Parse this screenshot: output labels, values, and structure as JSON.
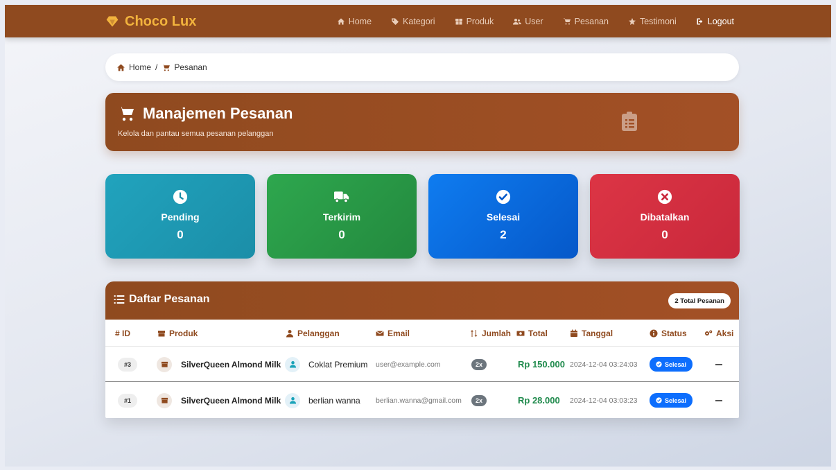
{
  "brand": {
    "name": "Choco Lux"
  },
  "nav": {
    "items": [
      {
        "label": "Home",
        "icon": "home-icon"
      },
      {
        "label": "Kategori",
        "icon": "tags-icon"
      },
      {
        "label": "Produk",
        "icon": "box-icon"
      },
      {
        "label": "User",
        "icon": "users-icon"
      },
      {
        "label": "Pesanan",
        "icon": "cart-icon"
      },
      {
        "label": "Testimoni",
        "icon": "star-icon"
      },
      {
        "label": "Logout",
        "icon": "logout-icon"
      }
    ]
  },
  "breadcrumb": {
    "home": "Home",
    "separator": "/",
    "current": "Pesanan"
  },
  "banner": {
    "title": "Manajemen Pesanan",
    "subtitle": "Kelola dan pantau semua pesanan pelanggan"
  },
  "stats": {
    "pending": {
      "label": "Pending",
      "value": "0"
    },
    "sent": {
      "label": "Terkirim",
      "value": "0"
    },
    "done": {
      "label": "Selesai",
      "value": "2"
    },
    "cancel": {
      "label": "Dibatalkan",
      "value": "0"
    }
  },
  "table": {
    "title": "Daftar Pesanan",
    "total_badge": "2 Total Pesanan",
    "columns": {
      "id": "# ID",
      "produk": "Produk",
      "pelanggan": "Pelanggan",
      "email": "Email",
      "jumlah": "Jumlah",
      "total": "Total",
      "tanggal": "Tanggal",
      "status": "Status",
      "aksi": "Aksi"
    },
    "rows": [
      {
        "id": "#3",
        "produk": "SilverQueen Almond Milk",
        "pelanggan": "Coklat Premium",
        "email": "user@example.com",
        "jumlah": "2x",
        "total": "Rp 150.000",
        "tanggal": "2024-12-04 03:24:03",
        "status": "Selesai"
      },
      {
        "id": "#1",
        "produk": "SilverQueen Almond Milk",
        "pelanggan": "berlian wanna",
        "email": "berlian.wanna@gmail.com",
        "jumlah": "2x",
        "total": "Rp 28.000",
        "tanggal": "2024-12-04 03:03:23",
        "status": "Selesai"
      }
    ]
  },
  "colors": {
    "brand_brown": "#8f4a1f",
    "brand_gold": "#f2b33d",
    "pending": "#1b9fb9",
    "sent": "#28a745",
    "done": "#0d6efd",
    "cancel": "#dc3545",
    "money_green": "#1f8a4c"
  }
}
